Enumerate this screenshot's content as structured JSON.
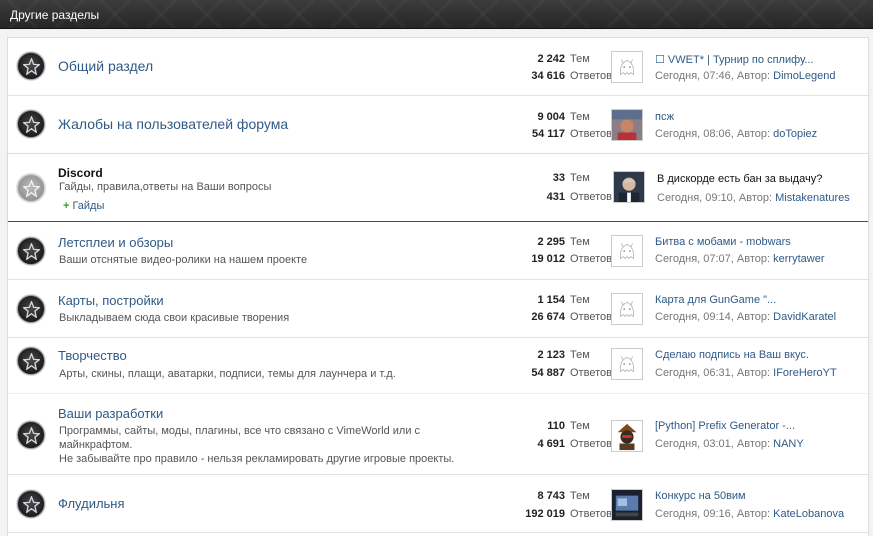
{
  "header": {
    "title": "Другие разделы"
  },
  "labels": {
    "threads": "Тем",
    "replies": "Ответов",
    "author_prefix": "Автор:"
  },
  "nodes": [
    {
      "title": "Общий раздел",
      "desc": "",
      "threads": "2 242",
      "replies": "34 616",
      "last_title": "☐ VWET* | Турнир по сплифу...",
      "last_date": "Сегодня, 07:46",
      "last_author": "DimoLegend",
      "avatar": "ghost-avatar"
    },
    {
      "title": "Жалобы на пользователей форума",
      "desc": "",
      "threads": "9 004",
      "replies": "54 117",
      "last_title": "псж",
      "last_date": "Сегодня, 08:06",
      "last_author": "doTopiez",
      "avatar": "photo-avatar"
    },
    {
      "title": "Discord",
      "desc": "Гайды, правила,ответы на Ваши вопросы",
      "sub": "Гайды",
      "threads": "33",
      "replies": "431",
      "last_title": "В дискорде есть бан за выдачу?",
      "last_date": "Сегодня, 09:10",
      "last_author": "Mistakenatures",
      "avatar": "portrait-avatar"
    },
    {
      "title": "Летсплеи и обзоры",
      "desc": "Ваши отснятые видео-ролики на нашем проекте",
      "threads": "2 295",
      "replies": "19 012",
      "last_title": "Битва с мобами - mobwars",
      "last_date": "Сегодня, 07:07",
      "last_author": "kerrytawer",
      "avatar": "ghost-avatar"
    },
    {
      "title": "Карты, постройки",
      "desc": "Выкладываем сюда свои красивые творения",
      "threads": "1 154",
      "replies": "26 674",
      "last_title": "Карта для GunGame \"...",
      "last_date": "Сегодня, 09:14",
      "last_author": "DavidKaratel",
      "avatar": "ghost-avatar"
    },
    {
      "title": "Творчество",
      "desc": "Арты, скины, плащи, аватарки, подписи, темы для лаунчера и т.д.",
      "threads": "2 123",
      "replies": "54 887",
      "last_title": "Сделаю подпись на Ваш вкус.",
      "last_date": "Сегодня, 06:31",
      "last_author": "IForeHeroYT",
      "avatar": "ghost-avatar"
    },
    {
      "title": "Ваши разработки",
      "desc1": "Программы, сайты, моды, плагины, все что связано с VimeWorld или с",
      "desc2": "майнкрафтом.",
      "desc3": "Не забывайте про правило - нельзя рекламировать другие игровые проекты.",
      "threads": "110",
      "replies": "4 691",
      "last_title": "[Python] Prefix Generator -...",
      "last_date": "Сегодня, 03:01",
      "last_author": "NANY",
      "avatar": "samurai-avatar"
    },
    {
      "title": "Флудильня",
      "desc": "",
      "threads": "8 743",
      "replies": "192 019",
      "last_title": "Конкурс на 50вим",
      "last_date": "Сегодня, 09:16",
      "last_author": "KateLobanova",
      "avatar": "screen-avatar"
    }
  ],
  "colors": {
    "link": "#2f5a86",
    "header_bg": "#2e2e2e"
  }
}
